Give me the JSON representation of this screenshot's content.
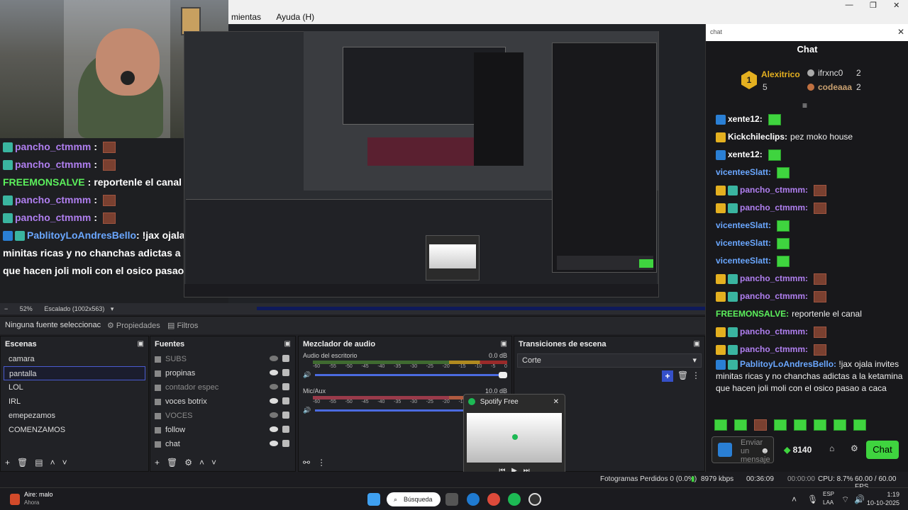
{
  "menu": {
    "item_tools": "mientas",
    "item_help": "Ayuda (H)"
  },
  "webcam_chat": [
    {
      "user": "pancho_ctmmm",
      "sep": ":",
      "color": "purple",
      "msg": ""
    },
    {
      "user": "pancho_ctmmm",
      "sep": ":",
      "color": "purple",
      "msg": ""
    },
    {
      "user": "FREEMONSALVE",
      "sep": ":",
      "color": "green",
      "msg": "reportenle el canal"
    },
    {
      "user": "pancho_ctmmm",
      "sep": ":",
      "color": "purple",
      "msg": ""
    },
    {
      "user": "pancho_ctmmm",
      "sep": ":",
      "color": "purple",
      "msg": ""
    }
  ],
  "webcam_long": {
    "user": "PablitoyLoAndresBello",
    "line1": ": !jax ojala invites",
    "line2": "minitas ricas y no chanchas adictas a la ketamina",
    "line3": "que hacen joli moli con el osico pasao a caca"
  },
  "zoom": {
    "percent": "52%",
    "mode": "Escalado (1002x563)"
  },
  "source_bar": {
    "no_source": "Ninguna fuente seleccionac",
    "properties": "Propiedades",
    "filters": "Filtros"
  },
  "scenes": {
    "title": "Escenas",
    "items": [
      "camara",
      "pantalla",
      "LOL",
      "IRL",
      "emepezamos",
      "COMENZAMOS"
    ],
    "selected_index": 1
  },
  "sources": {
    "title": "Fuentes",
    "items": [
      {
        "label": "SUBS",
        "visible": false
      },
      {
        "label": "propinas",
        "visible": true
      },
      {
        "label": "contador espec",
        "visible": false
      },
      {
        "label": "voces botrix",
        "visible": true
      },
      {
        "label": "VOCES",
        "visible": false
      },
      {
        "label": "follow",
        "visible": true
      },
      {
        "label": "chat",
        "visible": true
      }
    ]
  },
  "mixer": {
    "title": "Mezclador de audio",
    "tracks": [
      {
        "name": "Audio del escritorio",
        "db": "0.0 dB"
      },
      {
        "name": "Mic/Aux",
        "db": "10.0 dB"
      }
    ],
    "scale": [
      "-60",
      "-55",
      "-50",
      "-45",
      "-40",
      "-35",
      "-30",
      "-25",
      "-20",
      "-15",
      "-10",
      "-5",
      "0"
    ]
  },
  "transitions": {
    "title": "Transiciones de escena",
    "selected": "Corte"
  },
  "spotify": {
    "title": "Spotify Free"
  },
  "chat": {
    "search_placeholder": "chat",
    "title": "Chat",
    "leaderboard": {
      "first": {
        "rank": "1",
        "name": "Alexitrico",
        "count": "5"
      },
      "second": {
        "rank": "2",
        "name": "ifrxnc0",
        "count": "2"
      },
      "third": {
        "rank": "3",
        "name": "codeaaa",
        "count": "2"
      }
    },
    "messages": [
      {
        "user": "xente12:",
        "color": "#ffffff",
        "text": ""
      },
      {
        "user": "Kickchileclips:",
        "color": "#ffffff",
        "text": "pez moko house"
      },
      {
        "user": "xente12:",
        "color": "#ffffff",
        "text": ""
      },
      {
        "user": "vicenteeSlatt:",
        "color": "#6aa7ff",
        "text": ""
      },
      {
        "user": "pancho_ctmmm:",
        "color": "#b07ff0",
        "text": ""
      },
      {
        "user": "pancho_ctmmm:",
        "color": "#b07ff0",
        "text": ""
      },
      {
        "user": "vicenteeSlatt:",
        "color": "#6aa7ff",
        "text": ""
      },
      {
        "user": "vicenteeSlatt:",
        "color": "#6aa7ff",
        "text": ""
      },
      {
        "user": "vicenteeSlatt:",
        "color": "#6aa7ff",
        "text": ""
      },
      {
        "user": "pancho_ctmmm:",
        "color": "#b07ff0",
        "text": ""
      },
      {
        "user": "pancho_ctmmm:",
        "color": "#b07ff0",
        "text": ""
      },
      {
        "user": "FREEMONSALVE:",
        "color": "#5cf05c",
        "text": "reportenle el canal"
      },
      {
        "user": "pancho_ctmmm:",
        "color": "#b07ff0",
        "text": ""
      },
      {
        "user": "pancho_ctmmm:",
        "color": "#b07ff0",
        "text": ""
      }
    ],
    "long_msg": {
      "user": "PablitoyLoAndresBello:",
      "text": "!jax ojala invites minitas ricas y no chanchas adictas a la ketamina que hacen joli moli con el osico pasao a caca"
    },
    "input_placeholder": "Enviar un mensaje",
    "points": "8140",
    "send_label": "Chat"
  },
  "status": {
    "dropped": "Fotogramas Perdidos 0 (0.0%)",
    "kbps": "8979 kbps",
    "rec_time": "00:36:09",
    "stream_time": "00:00:00",
    "cpu": "CPU: 8.7%",
    "fps": "60.00 / 60.00 FPS"
  },
  "taskbar": {
    "weather_title": "Aire: malo",
    "weather_sub": "Ahora",
    "search": "Búsqueda",
    "lang": "ESP",
    "lang2": "LAA",
    "time": "1:19",
    "date": "10-10-2025"
  }
}
